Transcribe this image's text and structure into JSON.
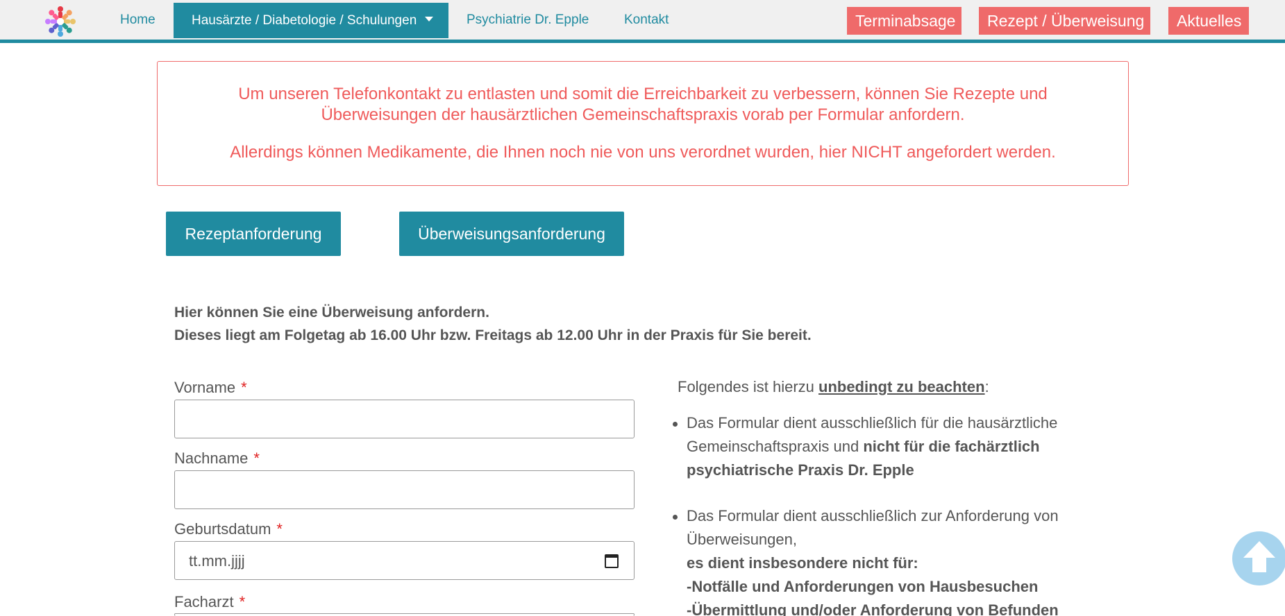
{
  "nav": {
    "home": "Home",
    "active": "Hausärzte / Diabetologie / Schulungen",
    "psychiatrie": "Psychiatrie Dr. Epple",
    "kontakt": "Kontakt",
    "terminabsage": "Terminabsage",
    "rezept": "Rezept / Überweisung",
    "aktuelles": "Aktuelles"
  },
  "notice": {
    "line1": "Um unseren Telefonkontakt zu entlasten und somit die Erreichbarkeit zu verbessern, können Sie Rezepte und",
    "line2": "Überweisungen der hausärztlichen Gemeinschaftspraxis vorab per Formular anfordern.",
    "line3": "Allerdings können Medikamente, die Ihnen noch nie von uns verordnet wurden, hier NICHT angefordert werden."
  },
  "buttons": {
    "rezeptanforderung": "Rezeptanforderung",
    "ueberweisungsanforderung": "Überweisungsanforderung"
  },
  "intro": {
    "line1": "Hier können Sie eine Überweisung anfordern.",
    "line2": "Dieses liegt am Folgetag ab 16.00 Uhr bzw. Freitags ab 12.00 Uhr in der Praxis für Sie bereit."
  },
  "form": {
    "vorname_label": "Vorname",
    "nachname_label": "Nachname",
    "geburtsdatum_label": "Geburtsdatum",
    "geburtsdatum_placeholder": "tt.mm.jjjj",
    "facharzt_label": "Facharzt",
    "required_mark": "*"
  },
  "notes": {
    "heading_pre": "Folgendes ist hierzu ",
    "heading_strong": "unbedingt zu beachten",
    "heading_post": ":",
    "item1_a": "Das Formular dient ausschließlich für die hausärztliche",
    "item1_b": "Gemeinschaftspraxis und ",
    "item1_c": "nicht für die fachärztlich",
    "item1_d": "psychiatrische Praxis Dr. Epple",
    "item2_a": "Das Formular dient ausschließlich zur Anforderung von",
    "item2_b": "Überweisungen,",
    "item2_c": "es dient insbesondere nicht für:",
    "item2_d": "-Notfälle und Anforderungen von Hausbesuchen",
    "item2_e": "-Übermittlung und/oder Anforderung von Befunden"
  },
  "icons": {
    "logo": "people-circle-logo",
    "calendar": "calendar-icon",
    "scroll_top": "arrow-up-icon"
  },
  "colors": {
    "teal": "#208ba0",
    "red": "#ef6a6a"
  }
}
